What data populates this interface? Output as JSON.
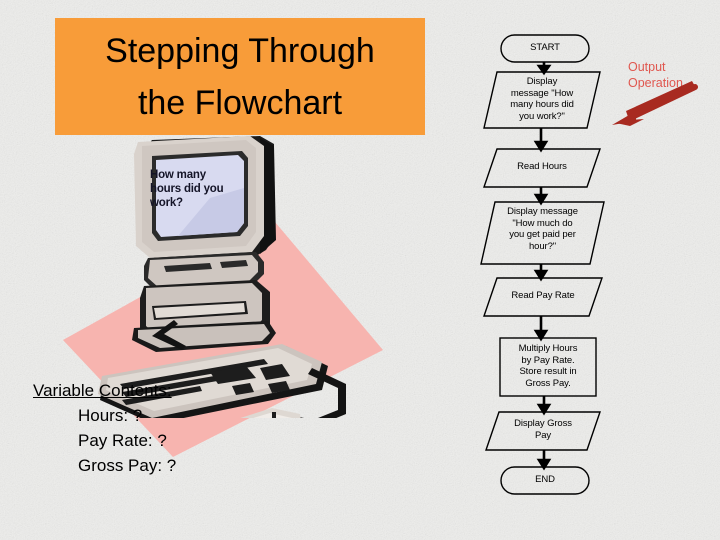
{
  "slide": {
    "title_lines": [
      "Stepping Through",
      "the Flowchart"
    ],
    "title_bg_color": "#f89c39",
    "background_color": "#ececeb"
  },
  "clipart": {
    "monitor_message": "How many hours did you work?",
    "backdrop_color": "#f7b5b0",
    "name": "computer-monitor-keyboard-mouse"
  },
  "variables": {
    "heading": "Variable Contents:",
    "items": [
      "Hours: ?",
      "Pay Rate: ?",
      "Gross Pay: ?"
    ]
  },
  "annotation": {
    "lines": [
      "Output",
      "Operation"
    ],
    "text_color": "#e0574f",
    "arrow_color": "#b22222",
    "points_to": "Display message \"How many hours did you work?\""
  },
  "flowchart": {
    "nodes": [
      {
        "id": "start",
        "shape": "terminator",
        "label": "START"
      },
      {
        "id": "display-hours-prompt",
        "shape": "parallelogram",
        "label": "Display message \"How many hours did you work?\""
      },
      {
        "id": "read-hours",
        "shape": "parallelogram",
        "label": "Read Hours"
      },
      {
        "id": "display-rate-prompt",
        "shape": "parallelogram",
        "label": "Display message \"How much do you get paid per hour?\""
      },
      {
        "id": "read-pay-rate",
        "shape": "parallelogram",
        "label": "Read Pay Rate"
      },
      {
        "id": "multiply",
        "shape": "process",
        "label": "Multiply Hours by Pay Rate. Store result in Gross Pay."
      },
      {
        "id": "display-gross",
        "shape": "parallelogram",
        "label": "Display Gross Pay"
      },
      {
        "id": "end",
        "shape": "terminator",
        "label": "END"
      }
    ],
    "node_labels": {
      "start": "START",
      "display_hours_prompt": [
        "Display",
        "message \"How",
        "many hours did",
        "you work?\""
      ],
      "read_hours": "Read Hours",
      "display_rate_prompt": [
        "Display message",
        "\"How much do",
        "you get paid per",
        "hour?\""
      ],
      "read_pay_rate": "Read Pay Rate",
      "multiply": [
        "Multiply Hours",
        "by Pay Rate.",
        "Store result in",
        "Gross Pay."
      ],
      "display_gross": [
        "Display Gross",
        "Pay"
      ],
      "end": "END"
    },
    "line_color": "#000000",
    "fill_color": "none"
  }
}
